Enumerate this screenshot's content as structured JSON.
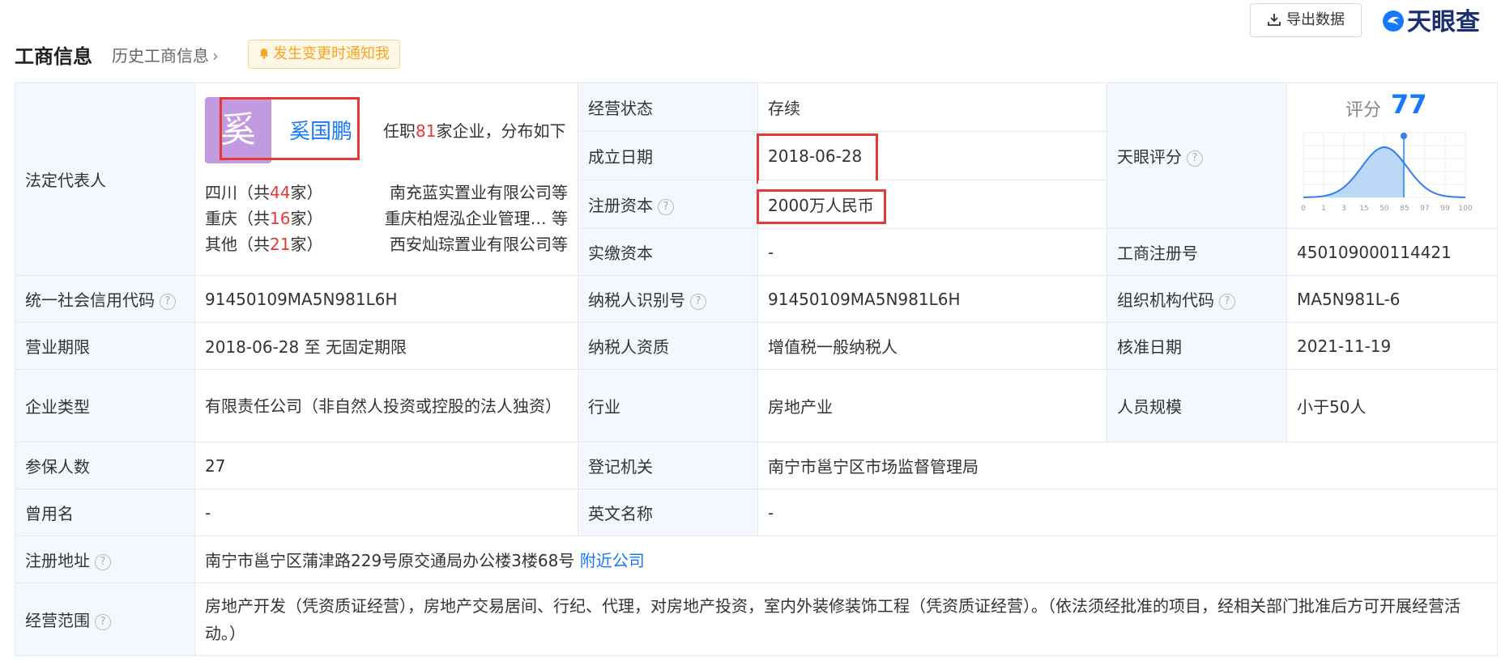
{
  "header": {
    "title": "工商信息",
    "history_link": "历史工商信息",
    "notify_button": "发生变更时通知我",
    "export_button": "导出数据",
    "logo_text": "天眼查"
  },
  "legal_rep": {
    "label": "法定代表人",
    "avatar_char": "奚",
    "name": "奚国鹏",
    "note_prefix": "任职",
    "note_count": "81",
    "note_suffix": "家企业，分布如下",
    "regions": [
      {
        "pre": "四川（共",
        "count": "44",
        "post": "家）",
        "company": "南充蓝实置业有限公司等"
      },
      {
        "pre": "重庆（共",
        "count": "16",
        "post": "家）",
        "company": "重庆柏煜泓企业管理…  等"
      },
      {
        "pre": "其他（共",
        "count": "21",
        "post": "家）",
        "company": "西安灿琮置业有限公司等"
      }
    ]
  },
  "fields": {
    "status_label": "经营状态",
    "status_value": "存续",
    "founded_label": "成立日期",
    "founded_value": "2018-06-28",
    "capital_label": "注册资本",
    "capital_value": "2000万人民币",
    "paidin_label": "实缴资本",
    "paidin_value": "-",
    "score_label": "天眼评分",
    "regno_label": "工商注册号",
    "regno_value": "450109000114421",
    "credit_label": "统一社会信用代码",
    "credit_value": "91450109MA5N981L6H",
    "taxid_label": "纳税人识别号",
    "taxid_value": "91450109MA5N981L6H",
    "orgcode_label": "组织机构代码",
    "orgcode_value": "MA5N981L-6",
    "term_label": "营业期限",
    "term_value": "2018-06-28 至 无固定期限",
    "taxqual_label": "纳税人资质",
    "taxqual_value": "增值税一般纳税人",
    "approve_label": "核准日期",
    "approve_value": "2021-11-19",
    "type_label": "企业类型",
    "type_value": "有限责任公司（非自然人投资或控股的法人独资）",
    "industry_label": "行业",
    "industry_value": "房地产业",
    "staff_label": "人员规模",
    "staff_value": "小于50人",
    "insured_label": "参保人数",
    "insured_value": "27",
    "authority_label": "登记机关",
    "authority_value": "南宁市邕宁区市场监督管理局",
    "former_label": "曾用名",
    "former_value": "-",
    "english_label": "英文名称",
    "english_value": "-",
    "address_label": "注册地址",
    "address_value": "南宁市邕宁区蒲津路229号原交通局办公楼3楼68号",
    "address_link": "附近公司",
    "scope_label": "经营范围",
    "scope_value": "房地产开发（凭资质证经营），房地产交易居间、行纪、代理，对房地产投资，室内外装修装饰工程（凭资质证经营）。（依法须经批准的项目，经相关部门批准后方可开展经营活动。）"
  },
  "score": {
    "label": "评分",
    "value": 77,
    "ticks": [
      "0",
      "1",
      "3",
      "15",
      "50",
      "85",
      "97",
      "99",
      "100"
    ]
  },
  "colors": {
    "accent": "#1677ff",
    "label_bg": "#f3f8ff",
    "highlight": "#e53935"
  }
}
